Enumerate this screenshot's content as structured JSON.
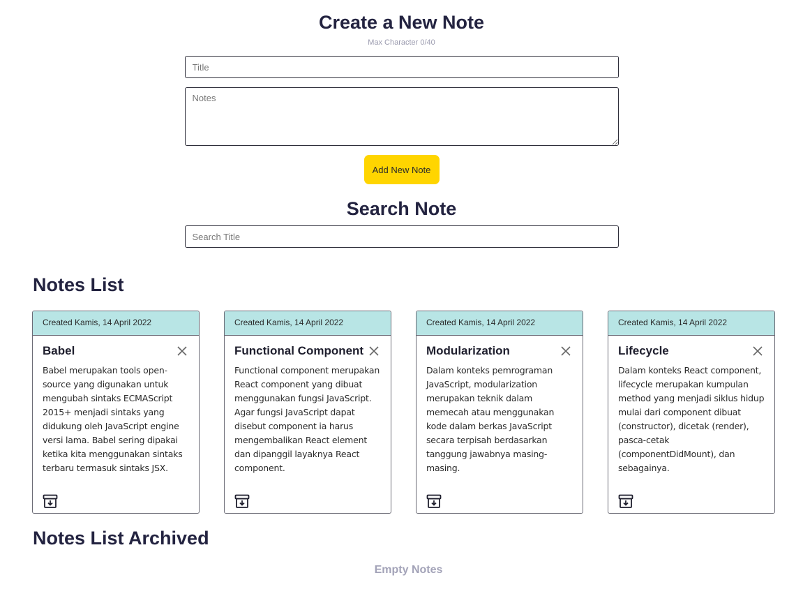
{
  "form": {
    "title": "Create a New Note",
    "max_char": "Max Character 0/40",
    "title_placeholder": "Title",
    "notes_placeholder": "Notes",
    "add_button": "Add New Note"
  },
  "search": {
    "title": "Search Note",
    "placeholder": "Search Title"
  },
  "notes_list": {
    "title": "Notes List",
    "items": [
      {
        "created": "Created Kamis, 14 April 2022",
        "title": "Babel",
        "body": "Babel merupakan tools open-source yang digunakan untuk mengubah sintaks ECMAScript 2015+ menjadi sintaks yang didukung oleh JavaScript engine versi lama. Babel sering dipakai ketika kita menggunakan sintaks terbaru termasuk sintaks JSX."
      },
      {
        "created": "Created Kamis, 14 April 2022",
        "title": "Functional Component",
        "body": "Functional component merupakan React component yang dibuat menggunakan fungsi JavaScript. Agar fungsi JavaScript dapat disebut component ia harus mengembalikan React element dan dipanggil layaknya React component."
      },
      {
        "created": "Created Kamis, 14 April 2022",
        "title": "Modularization",
        "body": "Dalam konteks pemrograman JavaScript, modularization merupakan teknik dalam memecah atau menggunakan kode dalam berkas JavaScript secara terpisah berdasarkan tanggung jawabnya masing-masing."
      },
      {
        "created": "Created Kamis, 14 April 2022",
        "title": "Lifecycle",
        "body": "Dalam konteks React component, lifecycle merupakan kumpulan method yang menjadi siklus hidup mulai dari component dibuat (constructor), dicetak (render), pasca-cetak (componentDidMount), dan sebagainya."
      }
    ]
  },
  "archived": {
    "title": "Notes List Archived",
    "empty": "Empty Notes"
  },
  "colors": {
    "accent_button": "#ffd500",
    "card_header": "#b8e5e5",
    "heading": "#232340",
    "muted": "#a3a3b8"
  },
  "icons": {
    "delete": "close-icon",
    "archive": "archive-icon"
  }
}
